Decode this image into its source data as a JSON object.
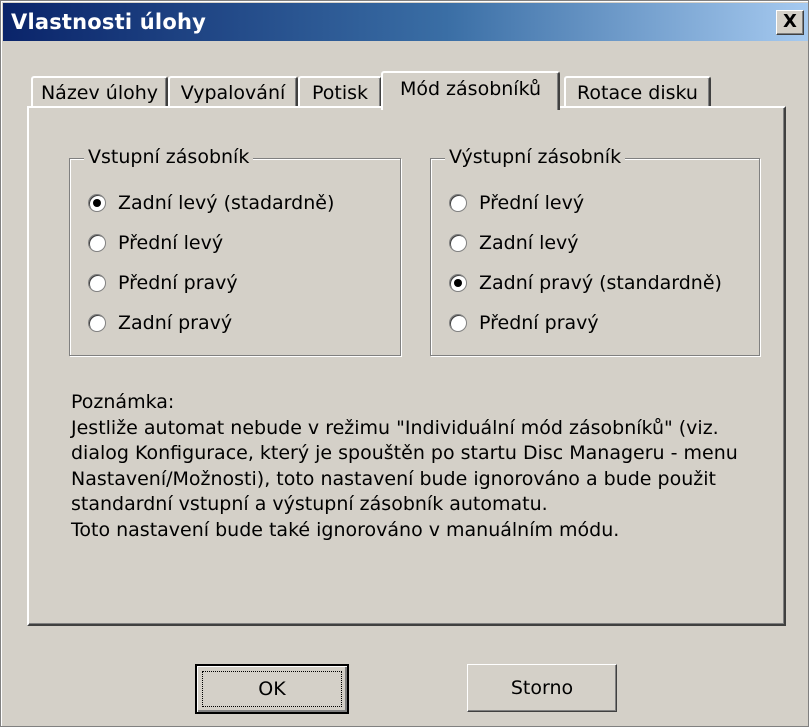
{
  "window": {
    "title": "Vlastnosti úlohy",
    "close_label": "X"
  },
  "tabs": [
    {
      "label": "Název úlohy",
      "active": false
    },
    {
      "label": "Vypalování",
      "active": false
    },
    {
      "label": "Potisk",
      "active": false
    },
    {
      "label": "Mód zásobníků",
      "active": true
    },
    {
      "label": "Rotace disku",
      "active": false
    }
  ],
  "input_tray": {
    "label": "Vstupní zásobník",
    "options": [
      {
        "label": "Zadní levý (stadardně)",
        "checked": true
      },
      {
        "label": "Přední levý",
        "checked": false
      },
      {
        "label": "Přední pravý",
        "checked": false
      },
      {
        "label": "Zadní pravý",
        "checked": false
      }
    ]
  },
  "output_tray": {
    "label": "Výstupní zásobník",
    "options": [
      {
        "label": "Přední levý",
        "checked": false
      },
      {
        "label": "Zadní levý",
        "checked": false
      },
      {
        "label": "Zadní pravý (standardně)",
        "checked": true
      },
      {
        "label": "Přední pravý",
        "checked": false
      }
    ]
  },
  "note": {
    "heading": "Poznámka:",
    "lines": [
      "Jestliže automat nebude v režimu \"Individuální mód zásobníků\" (viz.",
      "dialog Konfigurace, který je spouštěn po startu Disc Manageru - menu",
      "Nastavení/Možnosti), toto nastavení bude ignorováno a bude použit",
      "standardní vstupní a výstupní zásobník automatu.",
      "Toto nastavení bude také ignorováno v manuálním módu."
    ]
  },
  "buttons": {
    "ok": "OK",
    "cancel": "Storno"
  }
}
